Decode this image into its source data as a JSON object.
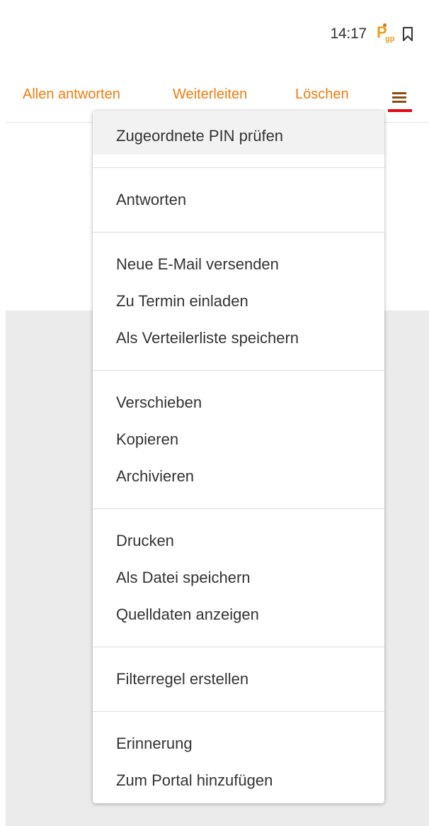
{
  "status": {
    "time": "14:17",
    "pgp_icon": {
      "main": "P",
      "sub": "gp",
      "color": "#e8a020"
    },
    "bookmark_icon": "bookmark-outline-icon"
  },
  "toolbar": {
    "reply_all": "Allen antworten",
    "forward": "Weiterleiten",
    "delete": "Löschen",
    "menu_icon": "hamburger-menu-icon",
    "accent_color": "#ee7d12",
    "active_underline_color": "#e30613"
  },
  "menu": {
    "groups": [
      {
        "items": [
          "Zugeordnete PIN prüfen"
        ]
      },
      {
        "items": [
          "Antworten"
        ]
      },
      {
        "items": [
          "Neue E-Mail versenden",
          "Zu Termin einladen",
          "Als Verteilerliste speichern"
        ]
      },
      {
        "items": [
          "Verschieben",
          "Kopieren",
          "Archivieren"
        ]
      },
      {
        "items": [
          "Drucken",
          "Als Datei speichern",
          "Quelldaten anzeigen"
        ]
      },
      {
        "items": [
          "Filterregel erstellen"
        ]
      },
      {
        "items": [
          "Erinnerung",
          "Zum Portal hinzufügen"
        ]
      }
    ]
  }
}
